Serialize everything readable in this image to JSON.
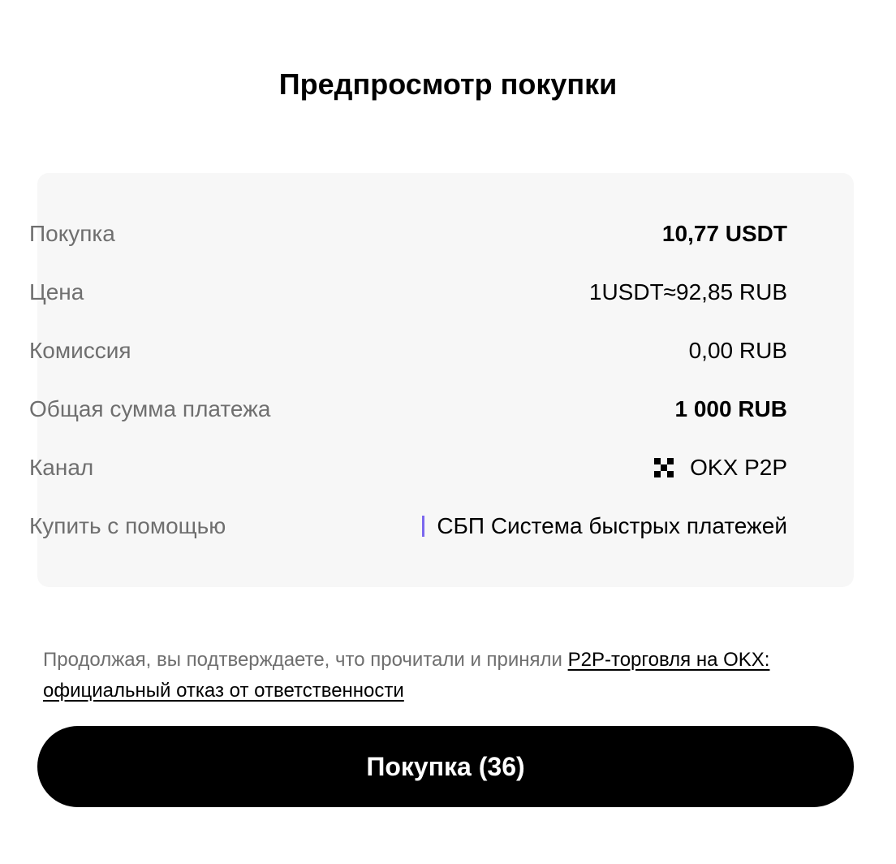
{
  "header": {
    "title": "Предпросмотр покупки"
  },
  "summary": {
    "purchase": {
      "label": "Покупка",
      "value": "10,77 USDT"
    },
    "price": {
      "label": "Цена",
      "value": "1USDT≈92,85 RUB"
    },
    "fee": {
      "label": "Комиссия",
      "value": "0,00 RUB"
    },
    "total": {
      "label": "Общая сумма платежа",
      "value": "1 000 RUB"
    },
    "channel": {
      "label": "Канал",
      "value": "OKX P2P",
      "icon": "okx-logo-icon"
    },
    "payment_method": {
      "label": "Купить с помощью",
      "value": "СБП Система быстрых платежей",
      "accent_color": "#7b68ee"
    }
  },
  "disclaimer": {
    "text": "Продолжая, вы подтверждаете, что прочитали и приняли ",
    "link_text": "P2P-торговля на OKX: официальный отказ от ответственности"
  },
  "buy_button": {
    "label": "Покупка (36)"
  },
  "colors": {
    "card_background": "#f7f7f7",
    "label_text": "#6f6f6f",
    "button_background": "#000000",
    "button_text": "#ffffff"
  }
}
